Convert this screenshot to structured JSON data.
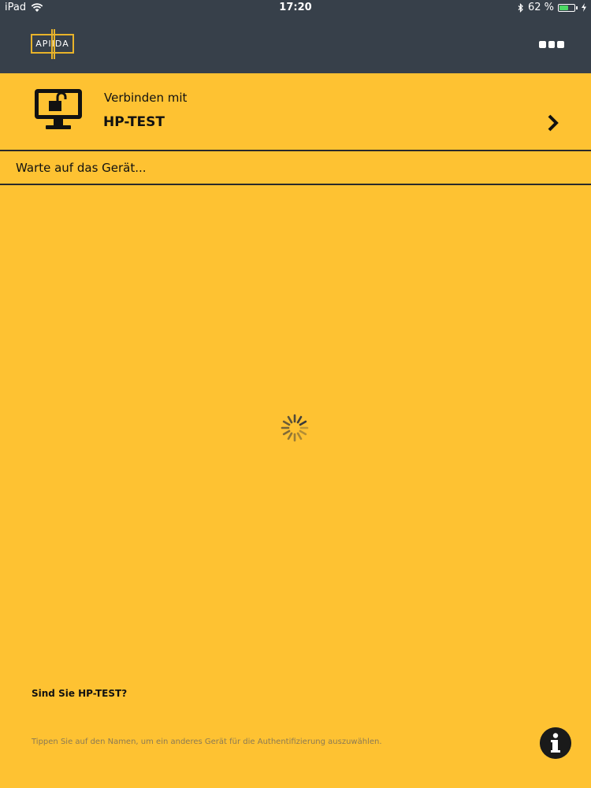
{
  "status_bar": {
    "device": "iPad",
    "time": "17:20",
    "battery_percent": "62 %",
    "battery_level": 0.62,
    "battery_color": "#4CD964"
  },
  "header": {
    "logo_text": "APIIDA",
    "menu_icon": "more-dots-icon"
  },
  "device_row": {
    "icon": "monitor-unlocked-icon",
    "connect_label": "Verbinden mit",
    "device_name": "HP-TEST",
    "chevron_icon": "chevron-right-icon"
  },
  "status": {
    "text": "Warte auf das Gerät..."
  },
  "footer": {
    "question": "Sind Sie HP-TEST?",
    "hint": "Tippen Sie auf den Namen, um ein anderes Gerät für die Authentifizierung auszuwählen.",
    "info_icon": "info-icon"
  },
  "colors": {
    "background": "#FEC232",
    "header": "#37404A",
    "accent": "#E8B32A"
  }
}
